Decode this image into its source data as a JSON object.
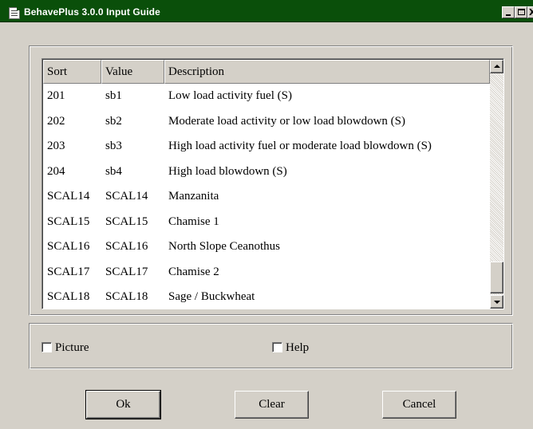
{
  "window": {
    "title": "BehavePlus 3.0.0 Input Guide",
    "title_bar_color": "#0a4f0a",
    "controls": {
      "minimize": "minimize-icon",
      "maximize": "maximize-icon",
      "close": "X"
    }
  },
  "table": {
    "columns": [
      "Sort",
      "Value",
      "Description"
    ],
    "rows": [
      {
        "sort": "201",
        "value": "sb1",
        "description": "Low load activity fuel (S)"
      },
      {
        "sort": "202",
        "value": "sb2",
        "description": "Moderate load activity or low load blowdown (S)"
      },
      {
        "sort": "203",
        "value": "sb3",
        "description": "High load activity fuel or moderate load blowdown (S)"
      },
      {
        "sort": "204",
        "value": "sb4",
        "description": "High load blowdown (S)"
      },
      {
        "sort": "SCAL14",
        "value": "SCAL14",
        "description": "Manzanita"
      },
      {
        "sort": "SCAL15",
        "value": "SCAL15",
        "description": "Chamise 1"
      },
      {
        "sort": "SCAL16",
        "value": "SCAL16",
        "description": "North Slope Ceanothus"
      },
      {
        "sort": "SCAL17",
        "value": "SCAL17",
        "description": "Chamise 2"
      },
      {
        "sort": "SCAL18",
        "value": "SCAL18",
        "description": "Sage / Buckwheat"
      }
    ],
    "scroll_position": 0.85
  },
  "options": {
    "picture_label": "Picture",
    "picture_checked": false,
    "help_label": "Help",
    "help_checked": false
  },
  "buttons": {
    "ok": "Ok",
    "clear": "Clear",
    "cancel": "Cancel"
  }
}
